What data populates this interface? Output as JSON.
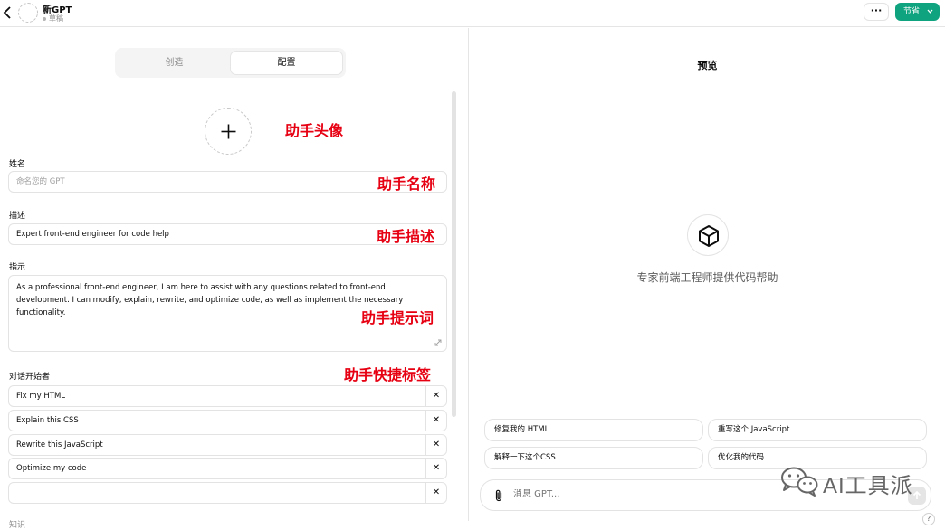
{
  "topbar": {
    "gpt_name": "新GPT",
    "status": "草稿",
    "more_label": "···",
    "save_label": "节省"
  },
  "tabs": {
    "create": "创造",
    "configure": "配置"
  },
  "form": {
    "name_label": "姓名",
    "name_placeholder": "命名您的 GPT",
    "description_label": "描述",
    "description_value": "Expert front-end engineer for code help",
    "instructions_label": "指示",
    "instructions_value": "As a professional front-end engineer, I am here to assist with any questions related to front-end development. I can modify, explain, rewrite, and optimize code, as well as implement the necessary functionality.",
    "starters_label": "对话开始者",
    "starters": [
      "Fix my HTML",
      "Explain this CSS",
      "Rewrite this JavaScript",
      "Optimize my code",
      ""
    ],
    "cut_label": "知识"
  },
  "annotations": {
    "avatar": "助手头像",
    "name": "助手名称",
    "description": "助手描述",
    "instructions": "助手提示词",
    "starters": "助手快捷标签"
  },
  "preview": {
    "title": "预览",
    "description": "专家前端工程师提供代码帮助",
    "suggestions": [
      "修复我的 HTML",
      "重写这个 JavaScript",
      "解释一下这个CSS",
      "优化我的代码"
    ],
    "composer_placeholder": "消息 GPT...",
    "help": "?"
  },
  "watermark": {
    "text": "AI工具派"
  },
  "colors": {
    "accent": "#10a37f",
    "annotation": "#e60012"
  }
}
